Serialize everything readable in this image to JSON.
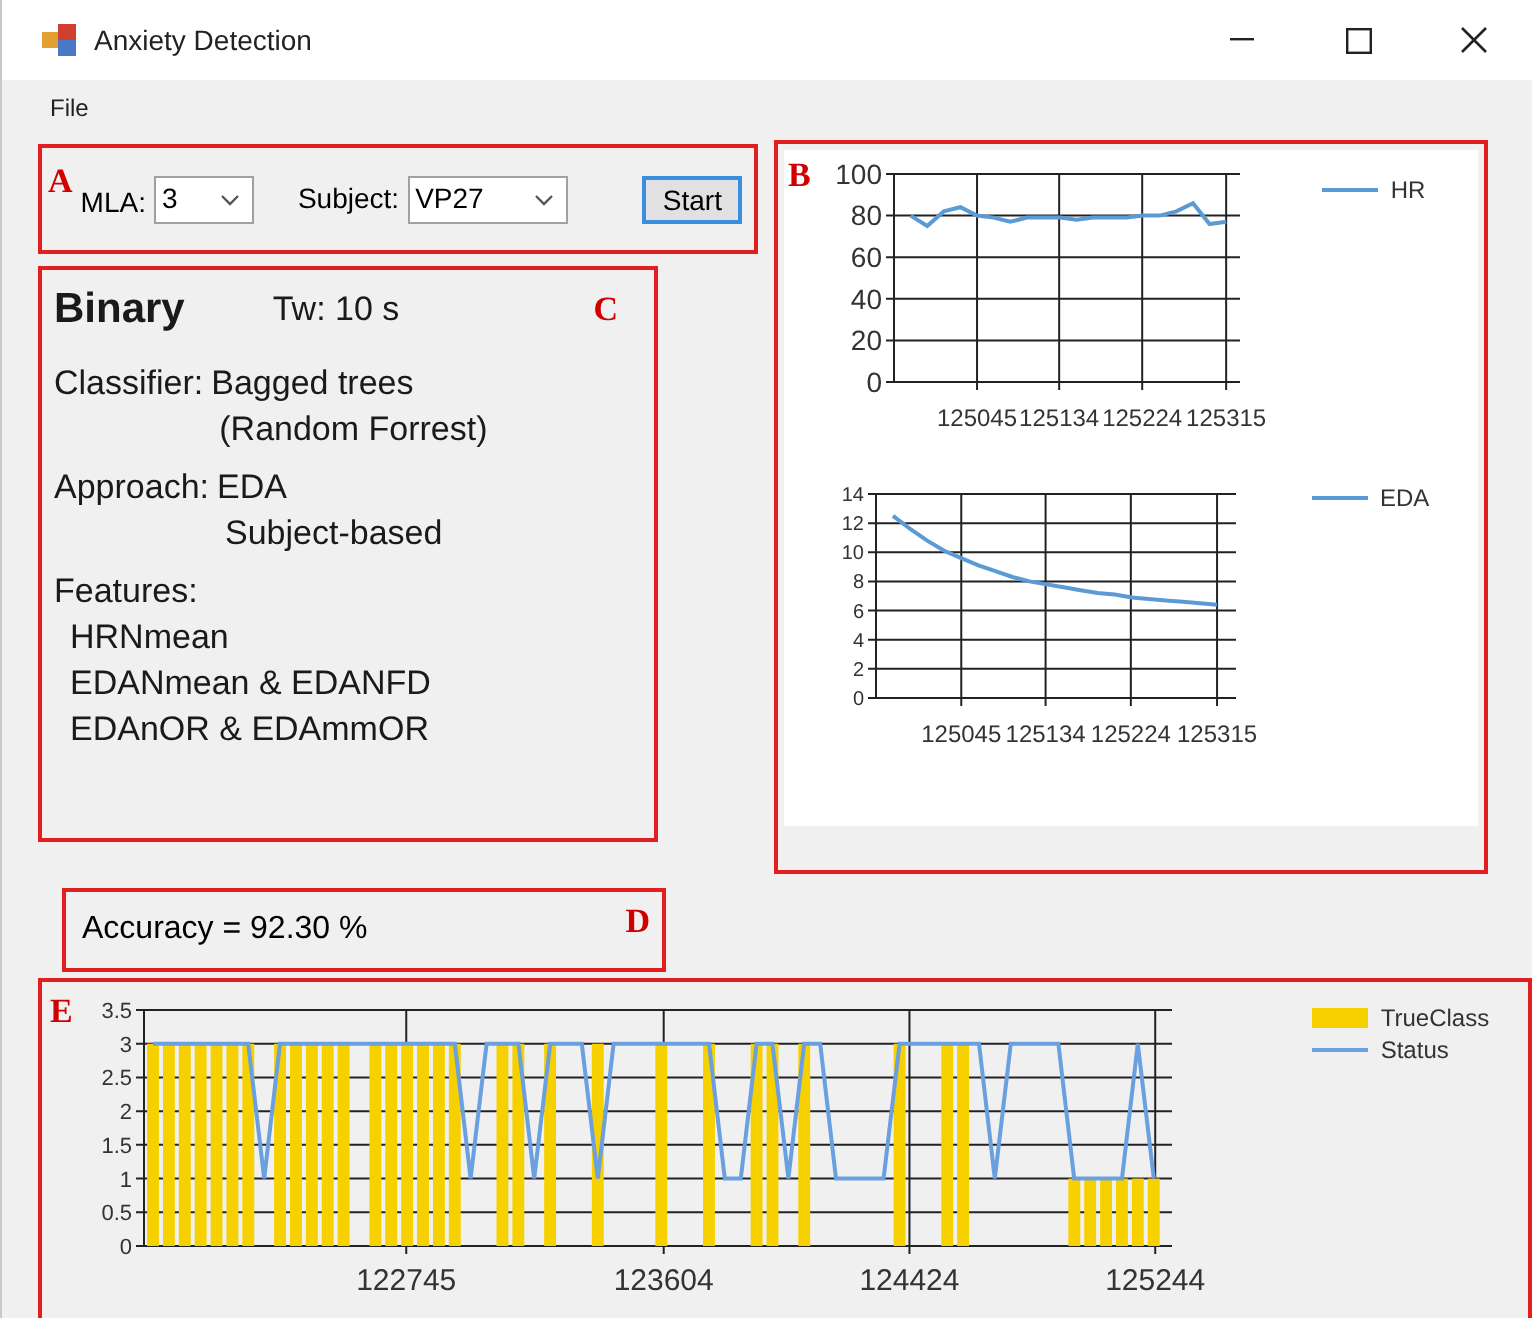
{
  "window": {
    "title": "Anxiety Detection"
  },
  "menu": [
    {
      "label": "File"
    }
  ],
  "panel_a": {
    "label": "A",
    "mla": {
      "label": "MLA:",
      "value": "3"
    },
    "subject": {
      "label": "Subject:",
      "value": "VP27"
    },
    "start_button": "Start"
  },
  "panel_b": {
    "label": "B",
    "hr_chart": {
      "chart_data": {
        "type": "line",
        "x": [
          124973,
          124991,
          125009,
          125027,
          125045,
          125063,
          125081,
          125099,
          125117,
          125135,
          125153,
          125171,
          125189,
          125207,
          125225,
          125243,
          125261,
          125279,
          125297,
          125315
        ],
        "grid": true,
        "legend": "right",
        "xlim": [
          124955,
          125330
        ],
        "ylim": [
          0,
          100
        ],
        "yticks": [
          0,
          20,
          40,
          60,
          80,
          100
        ],
        "xticks": [
          {
            "value": 125045,
            "label": "125045"
          },
          {
            "value": 125134,
            "label": "125134"
          },
          {
            "value": 125224,
            "label": "125224"
          },
          {
            "value": 125315,
            "label": "125315"
          }
        ],
        "series": [
          {
            "name": "HR",
            "color": "#5b9bd5",
            "values": [
              80,
              75,
              82,
              84,
              80,
              79,
              77,
              79,
              79,
              79,
              78,
              79,
              79,
              79,
              80,
              80,
              82,
              86,
              76,
              77
            ]
          }
        ]
      }
    },
    "eda_chart": {
      "chart_data": {
        "type": "line",
        "x": [
          124973,
          124991,
          125009,
          125027,
          125045,
          125063,
          125081,
          125099,
          125117,
          125135,
          125153,
          125171,
          125189,
          125207,
          125225,
          125243,
          125261,
          125279,
          125297,
          125315
        ],
        "grid": true,
        "legend": "right",
        "xlim": [
          124955,
          125335
        ],
        "ylim": [
          0,
          14
        ],
        "yticks": [
          0,
          2,
          4,
          6,
          8,
          10,
          12,
          14
        ],
        "xticks": [
          {
            "value": 125045,
            "label": "125045"
          },
          {
            "value": 125134,
            "label": "125134"
          },
          {
            "value": 125224,
            "label": "125224"
          },
          {
            "value": 125315,
            "label": "125315"
          }
        ],
        "series": [
          {
            "name": "EDA",
            "color": "#5b9bd5",
            "values": [
              12.5,
              11.6,
              10.8,
              10.1,
              9.6,
              9.1,
              8.7,
              8.3,
              8.0,
              7.8,
              7.6,
              7.4,
              7.2,
              7.1,
              6.9,
              6.8,
              6.7,
              6.6,
              6.5,
              6.4
            ]
          }
        ]
      }
    }
  },
  "panel_c": {
    "label": "C",
    "mode": "Binary",
    "time_window": "Tw: 10 s",
    "classifier": {
      "label": "Classifier:",
      "values": [
        "Bagged trees",
        "(Random Forrest)"
      ]
    },
    "approach": {
      "label": "Approach:",
      "values": [
        "EDA",
        "Subject-based"
      ]
    },
    "features": {
      "label": "Features:",
      "items": [
        "HRNmean",
        "EDANmean & EDANFD",
        "EDAnOR & EDAmmOR"
      ]
    }
  },
  "panel_d": {
    "label": "D",
    "accuracy": "Accuracy = 92.30 %"
  },
  "panel_e": {
    "label": "E",
    "chart_data": {
      "type": "bar",
      "x": [
        121900,
        121953,
        122006,
        122059,
        122112,
        122165,
        122218,
        122271,
        122324,
        122377,
        122430,
        122483,
        122536,
        122589,
        122642,
        122695,
        122748,
        122801,
        122854,
        122907,
        122960,
        123013,
        123066,
        123119,
        123172,
        123225,
        123278,
        123331,
        123384,
        123437,
        123490,
        123543,
        123596,
        123649,
        123702,
        123755,
        123808,
        123861,
        123914,
        123967,
        124020,
        124073,
        124126,
        124179,
        124232,
        124285,
        124338,
        124391,
        124444,
        124497,
        124550,
        124603,
        124656,
        124709,
        124762,
        124815,
        124868,
        124921,
        124974,
        125027,
        125080,
        125133,
        125186,
        125239
      ],
      "grid": true,
      "legend": "right",
      "xlim": [
        121870,
        125300
      ],
      "ylim": [
        0,
        3.5
      ],
      "yticks": [
        0,
        0.5,
        1,
        1.5,
        2,
        2.5,
        3,
        3.5
      ],
      "xticks": [
        {
          "value": 122745,
          "label": "122745"
        },
        {
          "value": 123604,
          "label": "123604"
        },
        {
          "value": 124424,
          "label": "124424"
        },
        {
          "value": 125244,
          "label": "125244"
        }
      ],
      "series": [
        {
          "name": "TrueClass",
          "type": "bar",
          "color": "#f7d000",
          "values": [
            3,
            3,
            3,
            3,
            3,
            3,
            3,
            0,
            3,
            3,
            3,
            3,
            3,
            0,
            3,
            3,
            3,
            3,
            3,
            3,
            0,
            0,
            3,
            3,
            0,
            3,
            0,
            0,
            3,
            0,
            0,
            0,
            3,
            0,
            0,
            3,
            0,
            0,
            3,
            3,
            0,
            3,
            0,
            0,
            0,
            0,
            0,
            3,
            0,
            0,
            3,
            3,
            0,
            0,
            0,
            0,
            0,
            0,
            1,
            1,
            1,
            1,
            1,
            1
          ]
        },
        {
          "name": "Status",
          "type": "line",
          "color": "#6a9fe0",
          "values": [
            3,
            3,
            3,
            3,
            3,
            3,
            3,
            1,
            3,
            3,
            3,
            3,
            3,
            3,
            3,
            3,
            3,
            3,
            3,
            3,
            1,
            3,
            3,
            3,
            1,
            3,
            3,
            3,
            1,
            3,
            3,
            3,
            3,
            3,
            3,
            3,
            1,
            1,
            3,
            3,
            1,
            3,
            3,
            1,
            1,
            1,
            1,
            3,
            3,
            3,
            3,
            3,
            3,
            1,
            3,
            3,
            3,
            3,
            1,
            1,
            1,
            1,
            3,
            1
          ]
        }
      ]
    }
  }
}
